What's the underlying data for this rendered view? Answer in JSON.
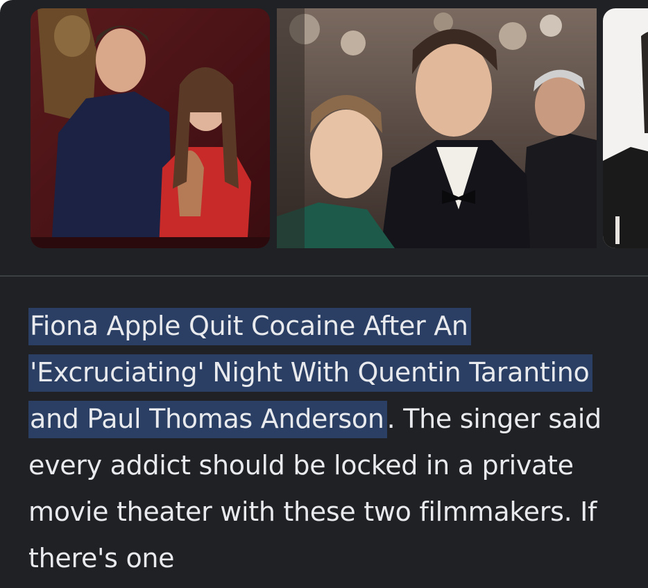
{
  "images": [
    {
      "alt": "photo-couple-oscars-1"
    },
    {
      "alt": "photo-couple-oscars-2"
    },
    {
      "alt": "photo-partial-3"
    }
  ],
  "article": {
    "headline": "Fiona Apple Quit Cocaine After An 'Excruciating' Night With Quentin Tarantino and Paul Thomas Anderson",
    "headline_end": ".",
    "snippet": "The singer said every addict should be locked in a private movie theater with these two filmmakers. If there's one"
  },
  "colors": {
    "background": "#202124",
    "text": "#e8eaed",
    "highlight": "#2a3f63",
    "divider": "#3c4043"
  }
}
